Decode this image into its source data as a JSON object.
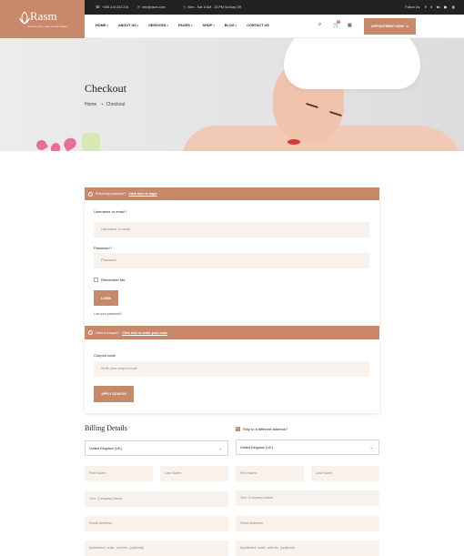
{
  "brand": {
    "name": "Rasm",
    "tagline": "Beauty Spa Care & Nail Salon"
  },
  "topbar": {
    "phone": "+256 214 203 215",
    "email": "info@rasm.com",
    "hours": "Mon - Sat: 8 AM - 15 PM Sunday Off",
    "follow_label": "Follow Us:",
    "socials": [
      "f",
      "t",
      "in",
      "▶",
      "◎"
    ]
  },
  "nav": {
    "items": [
      "HOME",
      "ABOUT US",
      "SERVICES",
      "PAGES",
      "SHOP",
      "BLOG",
      "CONTACT US"
    ],
    "cart_count": "0",
    "appointment_label": "APPOINTMENT NOW"
  },
  "hero": {
    "title": "Checkout",
    "breadcrumb": [
      "Home",
      "Checkout"
    ]
  },
  "login_notice": {
    "text": "Returning customer?",
    "link": "Click here to login"
  },
  "login": {
    "username_label": "Username or email *",
    "username_placeholder": "Username or email",
    "password_label": "Password *",
    "password_placeholder": "Password",
    "remember_label": "Remember Me",
    "button_label": "LOGIN",
    "lost_password": "Lost your password?"
  },
  "coupon_notice": {
    "text": "Have a coupon?",
    "link": "Click here to enter your code"
  },
  "coupon": {
    "label": "Coupon code",
    "placeholder": "Write your coupon code",
    "button_label": "APPLY COUPON"
  },
  "billing": {
    "title": "Billing Details",
    "country": "United Kingdom (UK)",
    "first_name": "First Name",
    "last_name": "Last Name",
    "company": "Your Company Name",
    "street": "Street Address",
    "apartment": "Apartment, suite, unit etc. (optional)"
  },
  "shipping": {
    "toggle_label": "Ship to a different address?",
    "country": "United Kingdom (UK)",
    "first_name": "First Name",
    "last_name": "Last Name",
    "company": "Your Company Name",
    "street": "Street Address",
    "apartment": "Apartment, suite, unit etc. (optional)"
  },
  "colors": {
    "accent": "#c8896b",
    "topbar": "#222222",
    "field_bg": "#f8f1ec"
  }
}
